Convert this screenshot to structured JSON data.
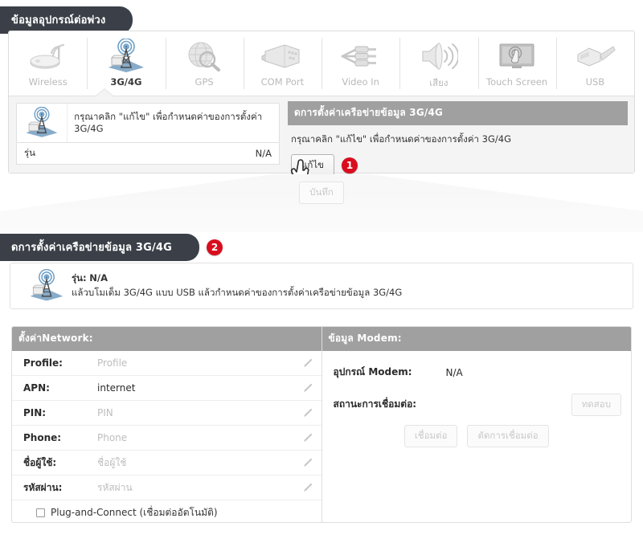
{
  "section1": {
    "title": "ข้อมูลอุปกรณ์ต่อพ่วง",
    "tabs": [
      {
        "label": "Wireless",
        "icon": "router-icon",
        "active": false
      },
      {
        "label": "3G/4G",
        "icon": "cell-tower-icon",
        "active": true
      },
      {
        "label": "GPS",
        "icon": "globe-magnifier-icon",
        "active": false
      },
      {
        "label": "COM Port",
        "icon": "serial-connector-icon",
        "active": false
      },
      {
        "label": "Video In",
        "icon": "rca-cable-icon",
        "active": false
      },
      {
        "label": "เสียง",
        "icon": "speaker-icon",
        "active": false
      },
      {
        "label": "Touch Screen",
        "icon": "touchscreen-icon",
        "active": false
      },
      {
        "label": "USB",
        "icon": "usb-connector-icon",
        "active": false
      }
    ],
    "left_card": {
      "icon": "cell-tower-icon",
      "note": "กรุณาคลิก \"แก้ไข\" เพื่อกำหนดค่าของการตั้งค่า 3G/4G",
      "model_label": "รุ่น",
      "model_value": "N/A"
    },
    "right_panel": {
      "header": "ดการตั้งค่าเครือข่ายข้อมูล 3G/4G",
      "note": "กรุณาคลิก \"แก้ไข\" เพื่อกำหนดค่าของการตั้งค่า 3G/4G",
      "edit_button": "แก้ไข",
      "step_badge": "1"
    },
    "save_button": "บันทึก"
  },
  "section2": {
    "title": "ดการตั้งค่าเครือข่ายข้อมูล 3G/4G",
    "step_badge": "2",
    "info": {
      "icon": "cell-tower-icon",
      "model_label": "รุ่น:",
      "model_value": "N/A",
      "description": "แล้วบโมเด็ม 3G/4G แบบ USB แล้วกำหนดค่าของการตั้งค่าเครือข่ายข้อมูล 3G/4G"
    },
    "network_panel": {
      "header": "ตั้งค่าNetwork:",
      "rows": [
        {
          "label": "Profile:",
          "value": "Profile",
          "is_placeholder": true
        },
        {
          "label": "APN:",
          "value": "internet",
          "is_placeholder": false
        },
        {
          "label": "PIN:",
          "value": "PIN",
          "is_placeholder": true
        },
        {
          "label": "Phone:",
          "value": "Phone",
          "is_placeholder": true
        },
        {
          "label": "ชื่อผู้ใช้:",
          "value": "ชื่อผู้ใช้",
          "is_placeholder": true
        },
        {
          "label": "รหัสผ่าน:",
          "value": "รหัสผ่าน",
          "is_placeholder": true
        }
      ],
      "checkbox_label": "Plug-and-Connect (เชื่อมต่ออัตโนมัติ)",
      "checkbox_checked": false
    },
    "modem_panel": {
      "header": "ข้อมูล Modem:",
      "device_label": "อุปกรณ์ Modem:",
      "device_value": "N/A",
      "status_label": "สถานะการเชื่อมต่อ:",
      "status_value": "",
      "test_button": "ทดสอบ",
      "connect_button": "เชื่อมต่อ",
      "disconnect_button": "ตัดการเชื่อมต่อ"
    }
  },
  "colors": {
    "title_bg": "#3b4048",
    "badge_red": "#d80d1e",
    "panel_header_grey": "#a0a0a0"
  }
}
